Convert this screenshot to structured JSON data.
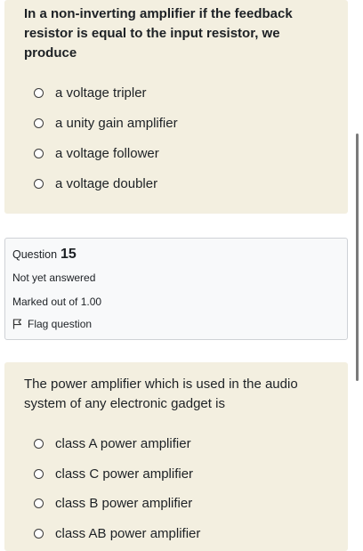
{
  "question_14": {
    "text": "In a non-inverting amplifier if the feedback resistor is equal to the input resistor, we produce",
    "options": [
      {
        "label": "a voltage tripler"
      },
      {
        "label": "a unity gain amplifier"
      },
      {
        "label": "a voltage follower"
      },
      {
        "label": "a voltage doubler"
      }
    ]
  },
  "question_15_info": {
    "prefix": "Question",
    "number": "15",
    "status": "Not yet answered",
    "marks": "Marked out of 1.00",
    "flag_label": "Flag question"
  },
  "question_15": {
    "text": "The power amplifier which is used in the audio system of any electronic gadget is",
    "options": [
      {
        "label": "class A power amplifier"
      },
      {
        "label": "class C power amplifier"
      },
      {
        "label": "class B power amplifier"
      },
      {
        "label": "class AB power amplifier"
      }
    ]
  }
}
